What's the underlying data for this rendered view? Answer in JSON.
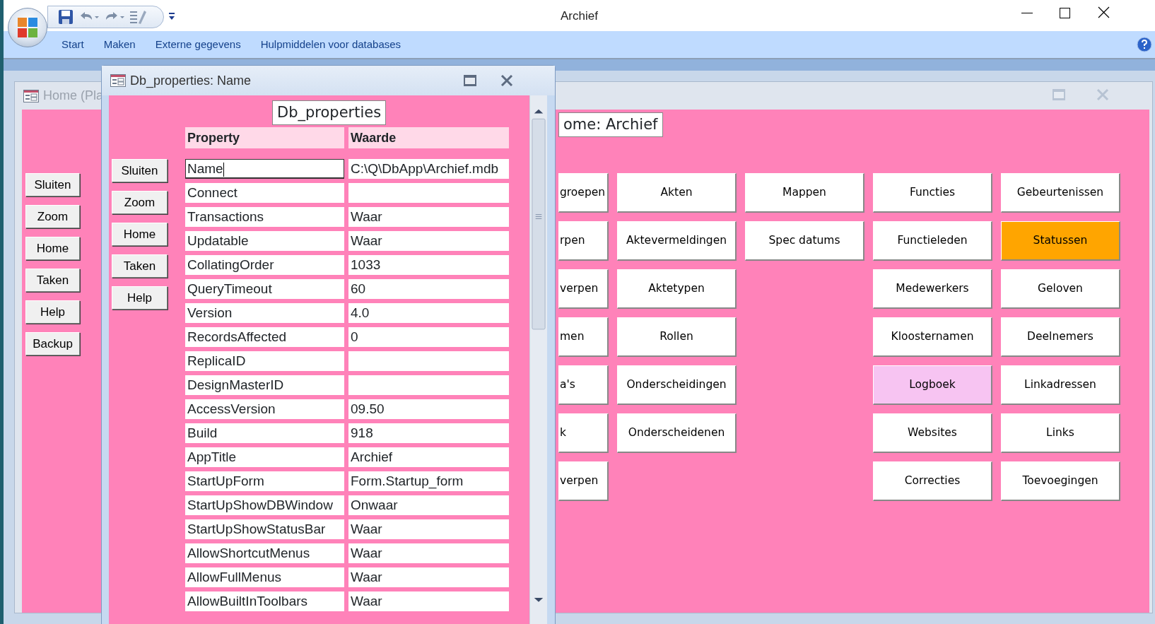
{
  "app": {
    "title": "Archief",
    "ribbon_tabs": [
      "Start",
      "Maken",
      "Externe gegevens",
      "Hulpmiddelen voor databases"
    ]
  },
  "home_window": {
    "title": "Home (Pla",
    "heading": "ome: Archief",
    "side_buttons": [
      "Sluiten",
      "Zoom",
      "Home",
      "Taken",
      "Help",
      "Backup"
    ],
    "grid": [
      {
        "buttons": [
          {
            "label": "groepen",
            "color": "#ffffff"
          },
          {
            "label": "rpen",
            "color": "#ffffff"
          },
          {
            "label": "verpen",
            "color": "#ffffff"
          },
          {
            "label": "men",
            "color": "#ffffff"
          },
          {
            "label": "a's",
            "color": "#ffffff"
          },
          {
            "label": "k",
            "color": "#ffffff"
          },
          {
            "label": "verpen",
            "color": "#ffffff"
          }
        ]
      },
      {
        "buttons": [
          {
            "label": "Akten",
            "color": "#ffffff"
          },
          {
            "label": "Aktevermeldingen",
            "color": "#ffffff"
          },
          {
            "label": "Aktetypen",
            "color": "#ffffff"
          },
          {
            "label": "Rollen",
            "color": "#ffffff"
          },
          {
            "label": "Onderscheidingen",
            "color": "#ffffff"
          },
          {
            "label": "Onderscheidenen",
            "color": "#ffffff"
          }
        ]
      },
      {
        "buttons": [
          {
            "label": "Mappen",
            "color": "#ffffff"
          },
          {
            "label": "Spec datums",
            "color": "#ffffff"
          }
        ]
      },
      {
        "buttons": [
          {
            "label": "Functies",
            "color": "#ffffff"
          },
          {
            "label": "Functieleden",
            "color": "#ffffff"
          },
          {
            "label": "Medewerkers",
            "color": "#ffffff"
          },
          {
            "label": "Kloosternamen",
            "color": "#ffffff"
          },
          {
            "label": "Logboek",
            "color": "#f7c4f2"
          },
          {
            "label": "Websites",
            "color": "#ffffff"
          },
          {
            "label": "Correcties",
            "color": "#ffffff"
          }
        ]
      },
      {
        "buttons": [
          {
            "label": "Gebeurtenissen",
            "color": "#ffffff"
          },
          {
            "label": "Statussen",
            "color": "#ffa500"
          },
          {
            "label": "Geloven",
            "color": "#ffffff"
          },
          {
            "label": "Deelnemers",
            "color": "#ffffff"
          },
          {
            "label": "Linkadressen",
            "color": "#ffffff"
          },
          {
            "label": "Links",
            "color": "#ffffff"
          },
          {
            "label": "Toevoegingen",
            "color": "#ffffff"
          }
        ]
      }
    ]
  },
  "properties_window": {
    "title": "Db_properties: Name",
    "heading": "Db_properties",
    "side_buttons": [
      "Sluiten",
      "Zoom",
      "Home",
      "Taken",
      "Help"
    ],
    "columns": [
      "Property",
      "Waarde"
    ],
    "rows": [
      {
        "property": "Name",
        "value": "C:\\Q\\DbApp\\Archief.mdb",
        "focused": true
      },
      {
        "property": "Connect",
        "focused": false
      },
      {
        "property": "Transactions",
        "value": "Waar",
        "focused": false
      },
      {
        "property": "Updatable",
        "value": "Waar",
        "focused": false
      },
      {
        "property": "CollatingOrder",
        "value": "1033",
        "focused": false
      },
      {
        "property": "QueryTimeout",
        "value": "60",
        "focused": false
      },
      {
        "property": "Version",
        "value": "4.0",
        "focused": false
      },
      {
        "property": "RecordsAffected",
        "value": "0",
        "focused": false
      },
      {
        "property": "ReplicaID",
        "focused": false
      },
      {
        "property": "DesignMasterID",
        "focused": false
      },
      {
        "property": "AccessVersion",
        "value": "09.50",
        "focused": false
      },
      {
        "property": "Build",
        "value": "918",
        "focused": false
      },
      {
        "property": "AppTitle",
        "value": "Archief",
        "focused": false
      },
      {
        "property": "StartUpForm",
        "value": "Form.Startup_form",
        "focused": false
      },
      {
        "property": "StartUpShowDBWindow",
        "value": "Onwaar",
        "focused": false
      },
      {
        "property": "StartUpShowStatusBar",
        "value": "Waar",
        "focused": false
      },
      {
        "property": "AllowShortcutMenus",
        "value": "Waar",
        "focused": false
      },
      {
        "property": "AllowFullMenus",
        "value": "Waar",
        "focused": false
      },
      {
        "property": "AllowBuiltInToolbars",
        "value": "Waar",
        "focused": false
      }
    ]
  }
}
